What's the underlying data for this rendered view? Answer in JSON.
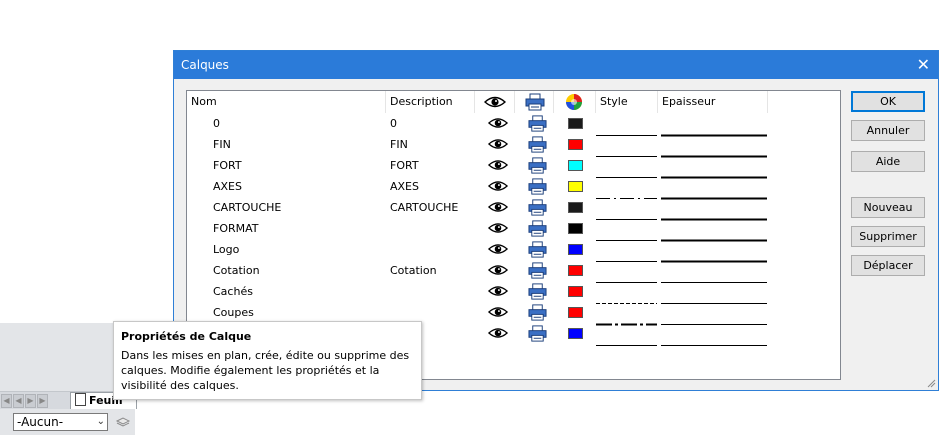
{
  "dialog": {
    "title": "Calques",
    "close_glyph": "✕",
    "columns": {
      "name": "Nom",
      "description": "Description",
      "visible_icon": "eye-icon",
      "print_icon": "printer-icon",
      "color_icon": "color-wheel-icon",
      "style": "Style",
      "thickness": "Epaisseur"
    },
    "layers": [
      {
        "name": "0",
        "description": "0",
        "color": "#1a1a1a",
        "style": "solid",
        "thickness": "thick"
      },
      {
        "name": "FIN",
        "description": "FIN",
        "color": "#ff0000",
        "style": "solid",
        "thickness": "thick"
      },
      {
        "name": "FORT",
        "description": "FORT",
        "color": "#00ffff",
        "style": "solid",
        "thickness": "thick"
      },
      {
        "name": "AXES",
        "description": "AXES",
        "color": "#ffff00",
        "style": "dash-dot",
        "thickness": "thick"
      },
      {
        "name": "CARTOUCHE",
        "description": "CARTOUCHE",
        "color": "#1a1a1a",
        "style": "solid",
        "thickness": "thick"
      },
      {
        "name": "FORMAT",
        "description": "",
        "color": "#000000",
        "style": "solid",
        "thickness": "thick"
      },
      {
        "name": "Logo",
        "description": "",
        "color": "#0000ff",
        "style": "solid",
        "thickness": "thick"
      },
      {
        "name": "Cotation",
        "description": "Cotation",
        "color": "#ff0000",
        "style": "solid",
        "thickness": "thin"
      },
      {
        "name": "Cachés",
        "description": "",
        "color": "#ff0000",
        "style": "dashed",
        "thickness": "thin"
      },
      {
        "name": "Coupes",
        "description": "",
        "color": "#ff0000",
        "style": "dash-dot-bold",
        "thickness": "thin"
      },
      {
        "name": "",
        "description": "",
        "color": "#0000ff",
        "style": "solid",
        "thickness": "thin"
      }
    ],
    "buttons": {
      "ok": "OK",
      "cancel": "Annuler",
      "help": "Aide",
      "new": "Nouveau",
      "delete": "Supprimer",
      "move": "Déplacer"
    }
  },
  "tooltip": {
    "title": "Propriétés de Calque",
    "body": "Dans les mises en plan, crée, édite ou supprime des calques. Modifie également les propriétés et la visibilité des calques."
  },
  "app": {
    "sheet_tab": "Feuill",
    "layer_select": "-Aucun-"
  }
}
